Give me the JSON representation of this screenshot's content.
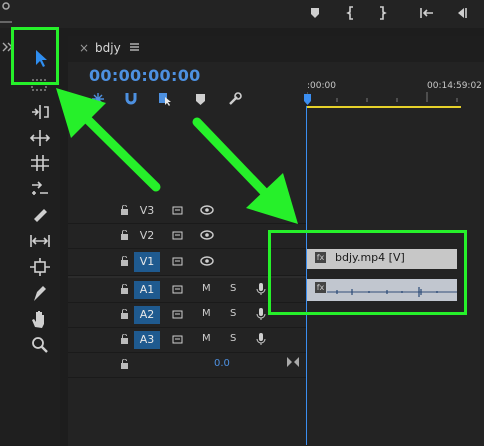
{
  "sequence": {
    "tab_name": "bdjy",
    "timecode": "00:00:00:00",
    "ruler_start": ":00:00",
    "ruler_end": "00:14:59:02"
  },
  "tracks": {
    "video": [
      {
        "name": "V3",
        "selected": false
      },
      {
        "name": "V2",
        "selected": false
      },
      {
        "name": "V1",
        "selected": true
      }
    ],
    "audio": [
      {
        "name": "A1",
        "selected": true,
        "m": "M",
        "s": "S"
      },
      {
        "name": "A2",
        "selected": true,
        "m": "M",
        "s": "S"
      },
      {
        "name": "A3",
        "selected": true,
        "m": "M",
        "s": "S"
      }
    ],
    "master_value": "0.0"
  },
  "clips": {
    "video_clip_label": "bdjy.mp4 [V]",
    "fx_badge": "fx"
  },
  "colors": {
    "accent_blue": "#4d90e0",
    "highlight_green": "#26f02a",
    "track_selected": "#1f5a8f",
    "work_area": "#e6d12a"
  },
  "icons": [
    "selection-tool-icon",
    "track-select-icon",
    "ripple-edit-icon",
    "rolling-edit-icon",
    "rate-stretch-icon",
    "razor-icon",
    "slip-icon",
    "slide-icon",
    "pen-icon",
    "hand-icon",
    "zoom-icon"
  ]
}
